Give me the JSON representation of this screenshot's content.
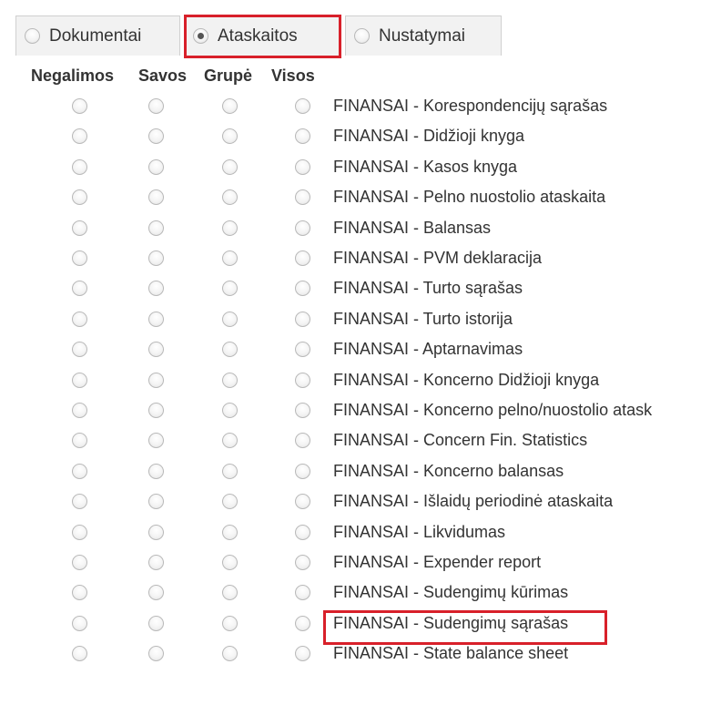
{
  "tabs": [
    {
      "label": "Dokumentai",
      "checked": false
    },
    {
      "label": "Ataskaitos",
      "checked": true
    },
    {
      "label": "Nustatymai",
      "checked": false
    }
  ],
  "columns": [
    "Negalimos",
    "Savos",
    "Grupė",
    "Visos"
  ],
  "reports": [
    "FINANSAI - Korespondencijų sąrašas",
    "FINANSAI - Didžioji knyga",
    "FINANSAI - Kasos knyga",
    "FINANSAI - Pelno nuostolio ataskaita",
    "FINANSAI - Balansas",
    "FINANSAI - PVM deklaracija",
    "FINANSAI - Turto sąrašas",
    "FINANSAI - Turto istorija",
    "FINANSAI - Aptarnavimas",
    "FINANSAI - Koncerno Didžioji knyga",
    "FINANSAI - Koncerno pelno/nuostolio atask",
    "FINANSAI - Concern Fin. Statistics",
    "FINANSAI - Koncerno balansas",
    "FINANSAI - Išlaidų periodinė ataskaita",
    "FINANSAI - Likvidumas",
    "FINANSAI - Expender report",
    "FINANSAI - Sudengimų kūrimas",
    "FINANSAI - Sudengimų sąrašas",
    "FINANSAI - State balance sheet"
  ],
  "highlight_color": "#d8202a"
}
